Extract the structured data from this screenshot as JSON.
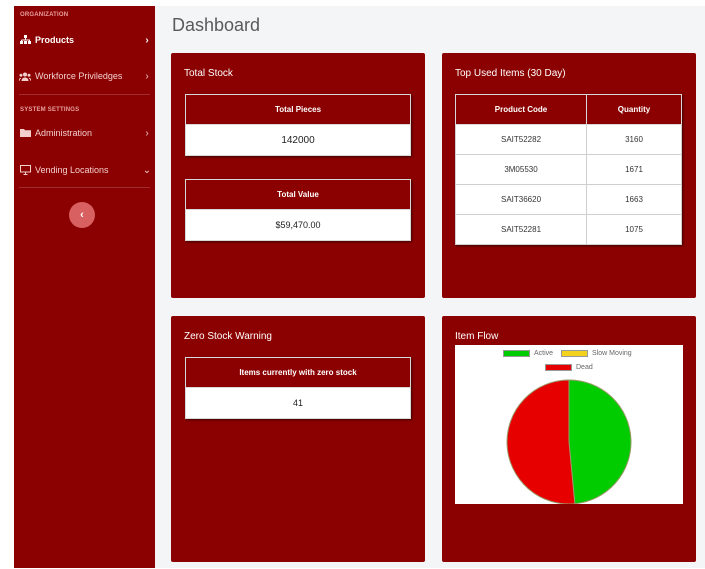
{
  "sidebar": {
    "organization_heading": "ORGANIZATION",
    "system_heading": "SYSTEM SETTINGS",
    "items": [
      {
        "label": "Products",
        "icon": "sitemap-icon",
        "chevron": "›"
      },
      {
        "label": "Workforce Priviledges",
        "icon": "users-icon",
        "chevron": "›"
      },
      {
        "label": "Administration",
        "icon": "folder-icon",
        "chevron": "›"
      },
      {
        "label": "Vending Locations",
        "icon": "monitor-icon",
        "chevron": "⌄"
      }
    ],
    "collapse_glyph": "‹"
  },
  "page": {
    "title": "Dashboard"
  },
  "total_stock": {
    "title": "Total Stock",
    "pieces_label": "Total Pieces",
    "pieces_value": "142000",
    "value_label": "Total Value",
    "value_value": "$59,470.00"
  },
  "top_used": {
    "title": "Top Used Items (30 Day)",
    "columns": [
      "Product Code",
      "Quantity"
    ],
    "rows": [
      [
        "SAIT52282",
        "3160"
      ],
      [
        "3M05530",
        "1671"
      ],
      [
        "SAIT36620",
        "1663"
      ],
      [
        "SAIT52281",
        "1075"
      ]
    ]
  },
  "zero_stock": {
    "title": "Zero Stock Warning",
    "label": "Items currently with zero stock",
    "value": "41"
  },
  "item_flow": {
    "title": "Item Flow",
    "legend": [
      {
        "label": "Active",
        "color": "#00cc00"
      },
      {
        "label": "Slow Moving",
        "color": "#f2d21c"
      },
      {
        "label": "Dead",
        "color": "#e60000"
      }
    ]
  },
  "chart_data": {
    "type": "pie",
    "title": "",
    "categories": [
      "Active",
      "Slow Moving",
      "Dead"
    ],
    "values": [
      48.5,
      0,
      51.5
    ],
    "colors": [
      "#00cc00",
      "#f2d21c",
      "#e60000"
    ],
    "legend_position": "top"
  },
  "colors": {
    "brand": "#8b0000",
    "sidebar_bg": "#8b0000",
    "main_bg": "#f4f5f7",
    "collapse_button": "#d96060"
  }
}
